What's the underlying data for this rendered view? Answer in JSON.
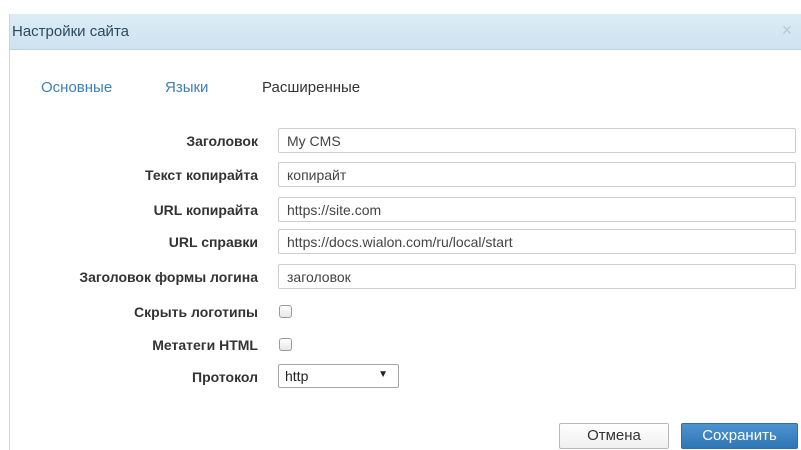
{
  "dialog": {
    "title": "Настройки сайта",
    "close_icon": "×"
  },
  "tabs": [
    {
      "label": "Основные",
      "active": false
    },
    {
      "label": "Языки",
      "active": false
    },
    {
      "label": "Расширенные",
      "active": true
    }
  ],
  "form": {
    "title": {
      "label": "Заголовок",
      "value": "My CMS"
    },
    "copyright_text": {
      "label": "Текст копирайта",
      "value": "копирайт"
    },
    "copyright_url": {
      "label": "URL копирайта",
      "value": "https://site.com"
    },
    "help_url": {
      "label": "URL справки",
      "value": "https://docs.wialon.com/ru/local/start"
    },
    "login_form_title": {
      "label": "Заголовок формы логина",
      "value": "заголовок"
    },
    "hide_logos": {
      "label": "Скрыть логотипы",
      "checked": false
    },
    "html_metatags": {
      "label": "Метатеги HTML",
      "checked": false
    },
    "protocol": {
      "label": "Протокол",
      "selected": "http",
      "arrow_icon": "▼"
    }
  },
  "buttons": {
    "cancel": "Отмена",
    "save": "Сохранить"
  },
  "colors": {
    "header_bg": "#d4e8f3",
    "link": "#3c7fb6",
    "primary_button": "#3a82c0"
  }
}
